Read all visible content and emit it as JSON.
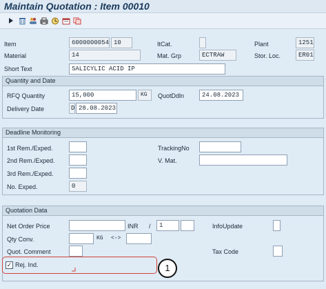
{
  "window": {
    "title": "Maintain Quotation : Item 00010"
  },
  "toolbar": {
    "icons": [
      "arrow-right-icon",
      "delete-icon",
      "partner-icon",
      "print-icon",
      "history-icon",
      "services-icon",
      "copy-icon"
    ]
  },
  "header": {
    "item_label": "Item",
    "item_number": "6000000054",
    "item_pos": "10",
    "itcat_label": "ItCat.",
    "itcat_value": "",
    "plant_label": "Plant",
    "plant_value": "1251",
    "material_label": "Material",
    "material_value": "14",
    "matgrp_label": "Mat. Grp",
    "matgrp_value": "ECTRAW",
    "storloc_label": "Stor. Loc.",
    "storloc_value": "ER01",
    "shorttext_label": "Short Text",
    "shorttext_value": "SALICYLIC ACID IP"
  },
  "quantity_date": {
    "title": "Quantity and Date",
    "rfq_qty_label": "RFQ Quantity",
    "rfq_qty_value": "15,000",
    "rfq_qty_unit": "KG",
    "quotddln_label": "QuotDdln",
    "quotddln_value": "24.08.2023",
    "delivery_label": "Delivery Date",
    "delivery_type": "D",
    "delivery_value": "28.08.2023"
  },
  "deadline": {
    "title": "Deadline Monitoring",
    "rem1_label": "1st Rem./Exped.",
    "rem1_value": "",
    "rem2_label": "2nd Rem./Exped.",
    "rem2_value": "",
    "rem3_label": "3rd Rem./Exped.",
    "rem3_value": "",
    "noexp_label": "No. Exped.",
    "noexp_value": "0",
    "tracking_label": "TrackingNo",
    "tracking_value": "",
    "vmat_label": "V. Mat.",
    "vmat_value": ""
  },
  "quotation": {
    "title": "Quotation Data",
    "netprice_label": "Net Order Price",
    "netprice_value": "",
    "currency": "INR",
    "per_sep": "/",
    "per_value": "1",
    "per_unit": "",
    "infoupdate_label": "InfoUpdate",
    "infoupdate_value": "",
    "qtyconv_label": "Qty Conv.",
    "qtyconv_value": "",
    "qtyconv_unit": "KG",
    "qtyconv_arrow": "<->",
    "qtyconv_target": "",
    "quotcomment_label": "Quot. Comment",
    "quotcomment_value": "",
    "taxcode_label": "Tax Code",
    "taxcode_value": "",
    "rejind_label": "Rej. Ind.",
    "rejind_checked": "✓"
  },
  "annotation": {
    "badge": "1"
  }
}
